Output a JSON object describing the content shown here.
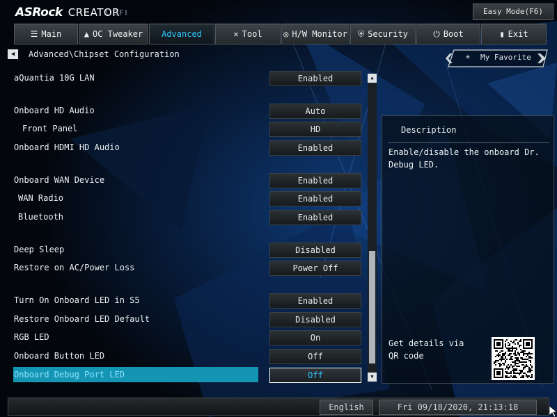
{
  "header": {
    "brand": "ASRock",
    "model": "CREATOR",
    "uefi": "UEFI",
    "easy_mode": "Easy Mode(F6)"
  },
  "tabs": [
    {
      "label": "Main",
      "icon": "list-icon"
    },
    {
      "label": "OC Tweaker",
      "icon": "rocket-icon"
    },
    {
      "label": "Advanced",
      "icon": "",
      "active": true
    },
    {
      "label": "Tool",
      "icon": "tools-icon"
    },
    {
      "label": "H/W Monitor",
      "icon": "monitor-icon"
    },
    {
      "label": "Security",
      "icon": "shield-icon"
    },
    {
      "label": "Boot",
      "icon": "power-icon"
    },
    {
      "label": "Exit",
      "icon": "exit-icon"
    }
  ],
  "breadcrumb": "Advanced\\Chipset Configuration",
  "favorite": "My Favorite",
  "settings": [
    {
      "label": "aQuantia 10G LAN",
      "value": "Enabled",
      "indent": 0
    },
    {
      "label": "Onboard HD Audio",
      "value": "Auto",
      "indent": 0
    },
    {
      "label": "Front Panel",
      "value": "HD",
      "indent": 1
    },
    {
      "label": "Onboard HDMI HD Audio",
      "value": "Enabled",
      "indent": 0
    },
    {
      "label": "Onboard WAN Device",
      "value": "Enabled",
      "indent": 0
    },
    {
      "label": "WAN Radio",
      "value": "Enabled",
      "indent": 2
    },
    {
      "label": "Bluetooth",
      "value": "Enabled",
      "indent": 2
    },
    {
      "label": "Deep Sleep",
      "value": "Disabled",
      "indent": 0
    },
    {
      "label": "Restore on AC/Power Loss",
      "value": "Power Off",
      "indent": 0
    },
    {
      "label": "Turn On Onboard LED in S5",
      "value": "Enabled",
      "indent": 0
    },
    {
      "label": "Restore Onboard LED Default",
      "value": "Disabled",
      "indent": 0
    },
    {
      "label": "RGB LED",
      "value": "On",
      "indent": 0
    },
    {
      "label": "Onboard Button LED",
      "value": "Off",
      "indent": 0
    },
    {
      "label": "Onboard Debug Port LED",
      "value": "Off",
      "indent": 0,
      "selected": true
    }
  ],
  "scroll": {
    "thumb_start": 0.58,
    "thumb_end": 0.97
  },
  "description": {
    "title": "Description",
    "text": "Enable/disable the onboard Dr. Debug LED.",
    "qr_text": "Get details via QR code"
  },
  "footer": {
    "language": "English",
    "datetime": "Fri 09/18/2020, 21:13:18"
  }
}
